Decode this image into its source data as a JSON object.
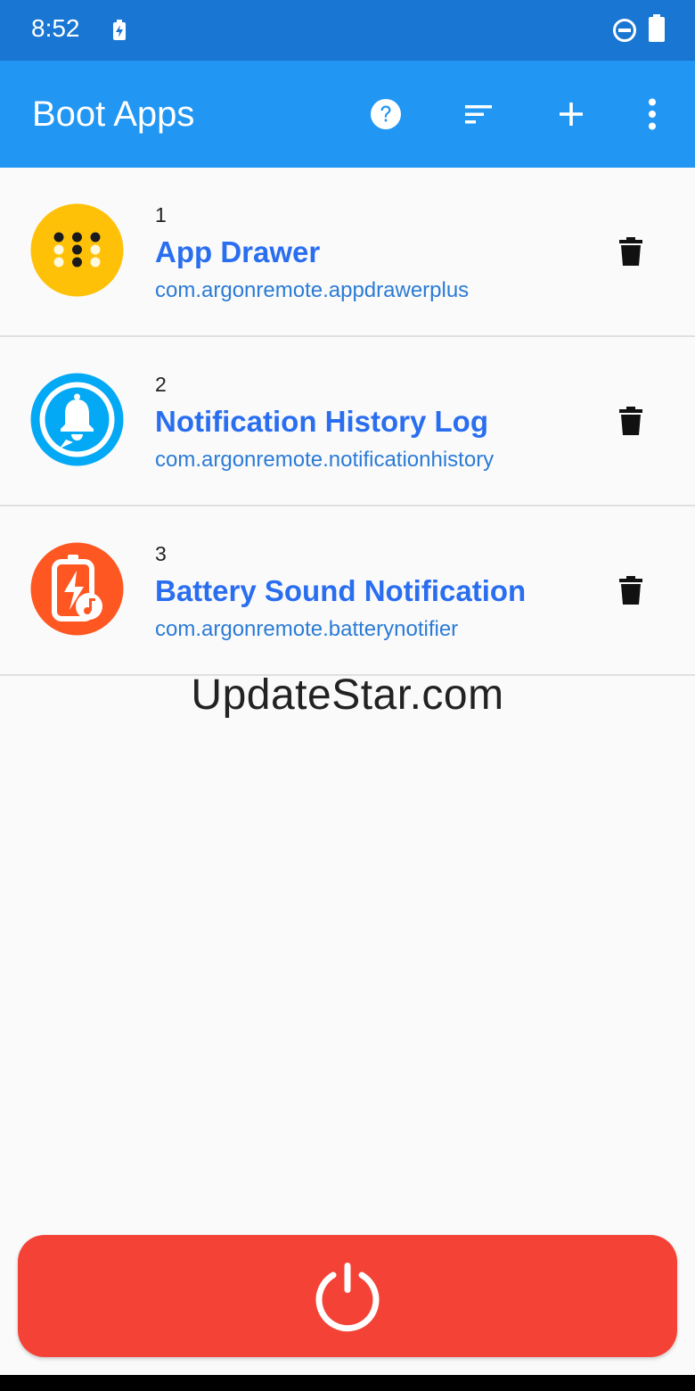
{
  "status_bar": {
    "time": "8:52",
    "icons": [
      "charging-icon",
      "do-not-disturb-icon",
      "battery-icon"
    ]
  },
  "app_bar": {
    "title": "Boot Apps",
    "actions": [
      "help-icon",
      "sort-icon",
      "add-icon",
      "more-vert-icon"
    ]
  },
  "apps": [
    {
      "order": "1",
      "name": "App Drawer",
      "package": "com.argonremote.appdrawerplus",
      "icon": "app-drawer-icon",
      "icon_color": "#ffc107"
    },
    {
      "order": "2",
      "name": "Notification History Log",
      "package": "com.argonremote.notificationhistory",
      "icon": "notification-bell-icon",
      "icon_color": "#03a9f4"
    },
    {
      "order": "3",
      "name": "Battery Sound Notification",
      "package": "com.argonremote.batterynotifier",
      "icon": "battery-sound-icon",
      "icon_color": "#ff5722"
    }
  ],
  "watermark": "UpdateStar.com",
  "power_button": {
    "icon": "power-icon",
    "color": "#f44336"
  },
  "colors": {
    "status_bar": "#1976d2",
    "app_bar": "#2196f3",
    "app_name": "#2a6ef0",
    "package_name": "#2b7bd6"
  }
}
